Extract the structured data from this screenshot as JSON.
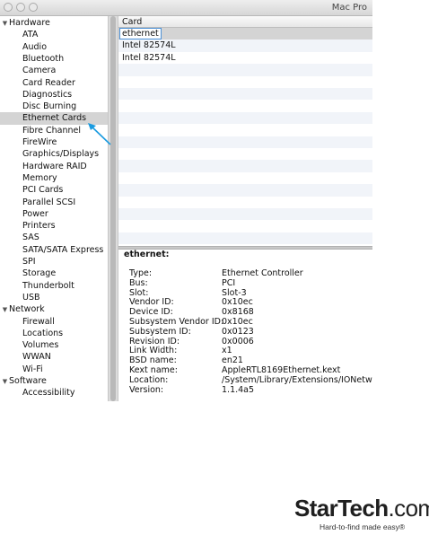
{
  "window": {
    "title": "Mac Pro"
  },
  "sidebar": {
    "rows": [
      {
        "type": "category",
        "label": "Hardware"
      },
      {
        "type": "item",
        "label": "ATA"
      },
      {
        "type": "item",
        "label": "Audio"
      },
      {
        "type": "item",
        "label": "Bluetooth"
      },
      {
        "type": "item",
        "label": "Camera"
      },
      {
        "type": "item",
        "label": "Card Reader"
      },
      {
        "type": "item",
        "label": "Diagnostics"
      },
      {
        "type": "item",
        "label": "Disc Burning"
      },
      {
        "type": "item",
        "label": "Ethernet Cards",
        "selected": true
      },
      {
        "type": "item",
        "label": "Fibre Channel"
      },
      {
        "type": "item",
        "label": "FireWire"
      },
      {
        "type": "item",
        "label": "Graphics/Displays"
      },
      {
        "type": "item",
        "label": "Hardware RAID"
      },
      {
        "type": "item",
        "label": "Memory"
      },
      {
        "type": "item",
        "label": "PCI Cards"
      },
      {
        "type": "item",
        "label": "Parallel SCSI"
      },
      {
        "type": "item",
        "label": "Power"
      },
      {
        "type": "item",
        "label": "Printers"
      },
      {
        "type": "item",
        "label": "SAS"
      },
      {
        "type": "item",
        "label": "SATA/SATA Express"
      },
      {
        "type": "item",
        "label": "SPI"
      },
      {
        "type": "item",
        "label": "Storage"
      },
      {
        "type": "item",
        "label": "Thunderbolt"
      },
      {
        "type": "item",
        "label": "USB"
      },
      {
        "type": "category",
        "label": "Network"
      },
      {
        "type": "item",
        "label": "Firewall"
      },
      {
        "type": "item",
        "label": "Locations"
      },
      {
        "type": "item",
        "label": "Volumes"
      },
      {
        "type": "item",
        "label": "WWAN"
      },
      {
        "type": "item",
        "label": "Wi-Fi"
      },
      {
        "type": "category",
        "label": "Software"
      },
      {
        "type": "item",
        "label": "Accessibility"
      }
    ]
  },
  "table": {
    "header": "Card",
    "rows": [
      "ethernet",
      "Intel 82574L",
      "Intel 82574L"
    ],
    "selected_index": 0,
    "empty_rows": 15
  },
  "details": {
    "title": "ethernet:",
    "fields": [
      {
        "label": "Type:",
        "value": "Ethernet Controller"
      },
      {
        "label": "Bus:",
        "value": "PCI"
      },
      {
        "label": "Slot:",
        "value": "Slot-3"
      },
      {
        "label": "Vendor ID:",
        "value": "0x10ec"
      },
      {
        "label": "Device ID:",
        "value": "0x8168"
      },
      {
        "label": "Subsystem Vendor ID:",
        "value": "0x10ec"
      },
      {
        "label": "Subsystem ID:",
        "value": "0x0123"
      },
      {
        "label": "Revision ID:",
        "value": "0x0006"
      },
      {
        "label": "Link Width:",
        "value": "x1"
      },
      {
        "label": "BSD name:",
        "value": "en21"
      },
      {
        "label": "Kext name:",
        "value": "AppleRTL8169Ethernet.kext"
      },
      {
        "label": "Location:",
        "value": "/System/Library/Extensions/IONetwo"
      },
      {
        "label": "Version:",
        "value": "1.1.4a5"
      }
    ]
  },
  "annotation": {
    "arrow_color": "#1a9be0"
  },
  "brand": {
    "name_bold": "StarTech",
    "name_light": ".com",
    "tagline": "Hard-to-find made easy®"
  },
  "colors": {
    "selection": "#d4d4d4",
    "focus_ring": "#4a8fd6",
    "alt_row": "#f1f4f9"
  }
}
